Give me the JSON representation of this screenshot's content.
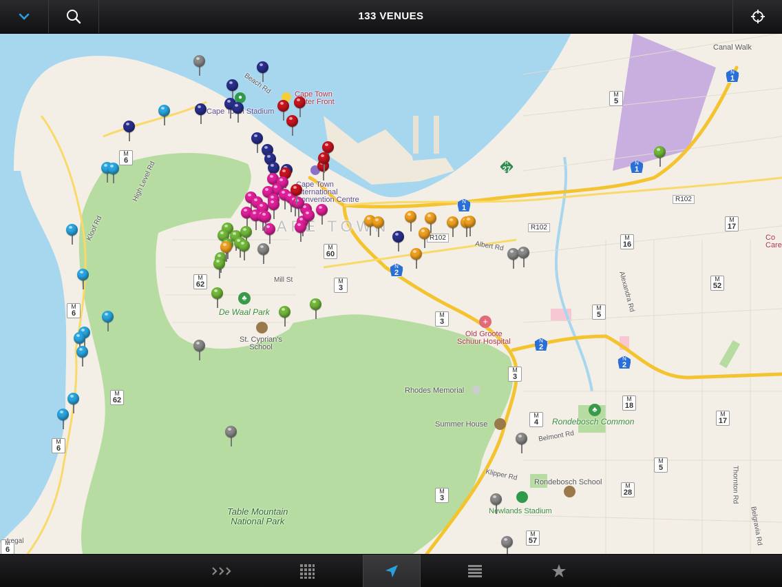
{
  "header": {
    "title": "133 VENUES",
    "icons": {
      "left": "chevron-down-icon",
      "search": "search-icon",
      "right": "locate-crosshair-icon"
    }
  },
  "map": {
    "labels": {
      "canal_walk": "Canal Walk",
      "waterfront": "Cape Town\nWater Front",
      "stadium": "Cape Town Stadium",
      "convention": "Cape Town\nInternational\nConvention Centre",
      "city": "CAPE TOWN",
      "beach_rd": "Beach Rd",
      "high_level_rd": "High Level Rd",
      "kloof_rd": "Kloof Rd",
      "mill_st": "Mill St",
      "albert_rd": "Albert Rd",
      "alexandra_rd": "Alexandra Rd",
      "de_waal_park": "De Waal Park",
      "st_cyprians": "St. Cyprian's\nSchool",
      "old_groote": "Old Groote\nSchuur Hospital",
      "rhodes": "Rhodes Memorial",
      "summer_house": "Summer House",
      "rondebosch_common": "Rondebosch Common",
      "belmont_rd": "Belmont Rd",
      "rondebosch_school": "Rondebosch School",
      "klipper_rd": "Klipper Rd",
      "newlands_stadium": "Newlands Stadium",
      "table_mountain": "Table Mountain\nNational Park",
      "thornton_rd": "Thornton Rd",
      "belgravia_rd": "Belgravia Rd",
      "care": "Co\nCare",
      "legal": "Legal"
    },
    "route_shields": [
      {
        "p": "M",
        "n": "5"
      },
      {
        "p": "M",
        "n": "6"
      },
      {
        "p": "M",
        "n": "60"
      },
      {
        "p": "M",
        "n": "62"
      },
      {
        "p": "M",
        "n": "3"
      },
      {
        "p": "M",
        "n": "6"
      },
      {
        "p": "M",
        "n": "62"
      },
      {
        "p": "M",
        "n": "6"
      },
      {
        "p": "M",
        "n": "3"
      },
      {
        "p": "M",
        "n": "3"
      },
      {
        "p": "M",
        "n": "4"
      },
      {
        "p": "M",
        "n": "3"
      },
      {
        "p": "M",
        "n": "57"
      },
      {
        "p": "M",
        "n": "16"
      },
      {
        "p": "M",
        "n": "52"
      },
      {
        "p": "M",
        "n": "5"
      },
      {
        "p": "M",
        "n": "18"
      },
      {
        "p": "M",
        "n": "17"
      },
      {
        "p": "M",
        "n": "17"
      },
      {
        "p": "M",
        "n": "5"
      },
      {
        "p": "M",
        "n": "28"
      },
      {
        "p": "M",
        "n": "6"
      }
    ],
    "national_shields": [
      {
        "p": "N",
        "n": "1"
      },
      {
        "p": "N",
        "n": "1"
      },
      {
        "p": "N",
        "n": "1"
      },
      {
        "p": "N",
        "n": "2"
      },
      {
        "p": "N",
        "n": "2"
      },
      {
        "p": "N",
        "n": "2"
      },
      {
        "p": "R",
        "n": "27"
      }
    ],
    "regional_routes": [
      "R102",
      "R102",
      "R102"
    ],
    "pin_colors": {
      "navy": "#2a2f8c",
      "sky": "#2aa6e0",
      "gray": "#8a8a8a",
      "red": "#c8141e",
      "magenta": "#e0209a",
      "green": "#72b83a",
      "orange": "#f0a020"
    },
    "colors": {
      "water": "#a7d6ef",
      "land": "#f3efe6",
      "park": "#b7dca1",
      "highway": "#f4c430",
      "industrial": "#c9aee0"
    }
  },
  "toolbar": {
    "items": [
      {
        "icon": "forward-arrows-icon"
      },
      {
        "icon": "grid-icon"
      },
      {
        "icon": "location-arrow-icon"
      },
      {
        "icon": "list-icon"
      },
      {
        "icon": "star-icon"
      }
    ],
    "active": 2
  }
}
